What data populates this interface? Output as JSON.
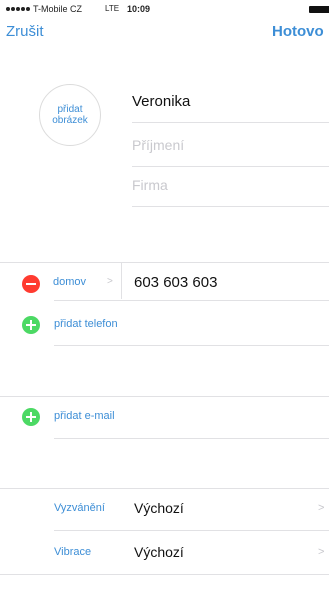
{
  "status_bar": {
    "carrier": "T-Mobile CZ",
    "network": "LTE",
    "time": "10:09"
  },
  "nav": {
    "cancel": "Zrušit",
    "done": "Hotovo"
  },
  "photo": {
    "line1": "přidat",
    "line2": "obrázek"
  },
  "name": {
    "first": "Veronika",
    "last_placeholder": "Příjmení",
    "company_placeholder": "Firma"
  },
  "phone": {
    "label": "domov",
    "chevron": ">",
    "number": "603 603 603",
    "add": "přidat telefon"
  },
  "email": {
    "add": "přidat e-mail"
  },
  "settings": {
    "ringtone_label": "Vyzvánění",
    "ringtone_value": "Výchozí",
    "vibration_label": "Vibrace",
    "vibration_value": "Výchozí",
    "chevron": ">"
  },
  "colors": {
    "accent": "#3d8ed6",
    "add": "#4cd964",
    "remove": "#ff3b30",
    "placeholder": "#c9c9ce"
  }
}
